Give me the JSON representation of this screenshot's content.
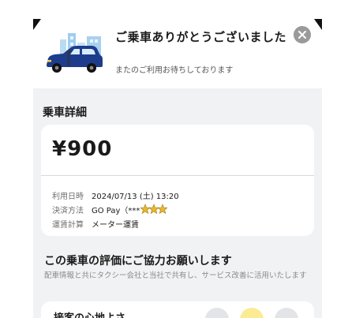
{
  "header": {
    "title": "ご乗車ありがとうございました",
    "subtitle": "またのご利用お待ちしております"
  },
  "details": {
    "section_title": "乗車詳細",
    "price": "¥900",
    "rows": [
      {
        "label": "利用日時",
        "value": "2024/07/13 (土) 13:20"
      },
      {
        "label": "決済方法",
        "value": "GO Pay（***"
      },
      {
        "label": "運賃計算",
        "value": "メーター運賃"
      }
    ]
  },
  "rating": {
    "title": "この乗車の評価にご協力お願いします",
    "subtitle": "配車情報と共にタクシー会社と当社で共有し、サービス改善に活用いたします",
    "first_item_label": "接客の心地よさ"
  },
  "colors": {
    "accent": "#1e3c8c",
    "sheet_background": "#f1f2f4",
    "close_button": "#9a9a9a",
    "star_gold": "#e8b82e"
  },
  "icons": {
    "close": "close-icon",
    "illustration": "taxi-city-illustration",
    "payment_mask": "star-mask-icons"
  }
}
